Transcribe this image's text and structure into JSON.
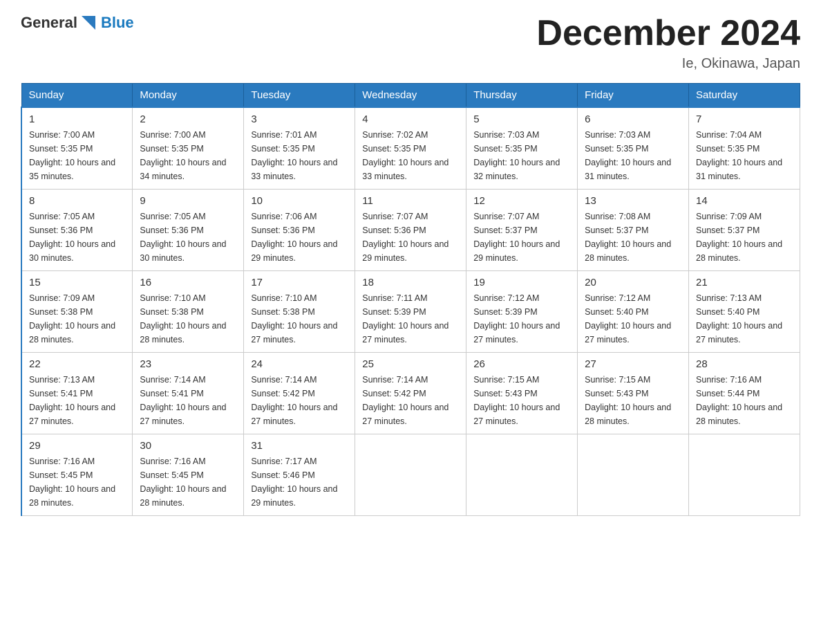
{
  "header": {
    "logo_general": "General",
    "logo_blue": "Blue",
    "title": "December 2024",
    "location": "Ie, Okinawa, Japan"
  },
  "days_of_week": [
    "Sunday",
    "Monday",
    "Tuesday",
    "Wednesday",
    "Thursday",
    "Friday",
    "Saturday"
  ],
  "weeks": [
    [
      {
        "day": "1",
        "sunrise": "7:00 AM",
        "sunset": "5:35 PM",
        "daylight": "10 hours and 35 minutes."
      },
      {
        "day": "2",
        "sunrise": "7:00 AM",
        "sunset": "5:35 PM",
        "daylight": "10 hours and 34 minutes."
      },
      {
        "day": "3",
        "sunrise": "7:01 AM",
        "sunset": "5:35 PM",
        "daylight": "10 hours and 33 minutes."
      },
      {
        "day": "4",
        "sunrise": "7:02 AM",
        "sunset": "5:35 PM",
        "daylight": "10 hours and 33 minutes."
      },
      {
        "day": "5",
        "sunrise": "7:03 AM",
        "sunset": "5:35 PM",
        "daylight": "10 hours and 32 minutes."
      },
      {
        "day": "6",
        "sunrise": "7:03 AM",
        "sunset": "5:35 PM",
        "daylight": "10 hours and 31 minutes."
      },
      {
        "day": "7",
        "sunrise": "7:04 AM",
        "sunset": "5:35 PM",
        "daylight": "10 hours and 31 minutes."
      }
    ],
    [
      {
        "day": "8",
        "sunrise": "7:05 AM",
        "sunset": "5:36 PM",
        "daylight": "10 hours and 30 minutes."
      },
      {
        "day": "9",
        "sunrise": "7:05 AM",
        "sunset": "5:36 PM",
        "daylight": "10 hours and 30 minutes."
      },
      {
        "day": "10",
        "sunrise": "7:06 AM",
        "sunset": "5:36 PM",
        "daylight": "10 hours and 29 minutes."
      },
      {
        "day": "11",
        "sunrise": "7:07 AM",
        "sunset": "5:36 PM",
        "daylight": "10 hours and 29 minutes."
      },
      {
        "day": "12",
        "sunrise": "7:07 AM",
        "sunset": "5:37 PM",
        "daylight": "10 hours and 29 minutes."
      },
      {
        "day": "13",
        "sunrise": "7:08 AM",
        "sunset": "5:37 PM",
        "daylight": "10 hours and 28 minutes."
      },
      {
        "day": "14",
        "sunrise": "7:09 AM",
        "sunset": "5:37 PM",
        "daylight": "10 hours and 28 minutes."
      }
    ],
    [
      {
        "day": "15",
        "sunrise": "7:09 AM",
        "sunset": "5:38 PM",
        "daylight": "10 hours and 28 minutes."
      },
      {
        "day": "16",
        "sunrise": "7:10 AM",
        "sunset": "5:38 PM",
        "daylight": "10 hours and 28 minutes."
      },
      {
        "day": "17",
        "sunrise": "7:10 AM",
        "sunset": "5:38 PM",
        "daylight": "10 hours and 27 minutes."
      },
      {
        "day": "18",
        "sunrise": "7:11 AM",
        "sunset": "5:39 PM",
        "daylight": "10 hours and 27 minutes."
      },
      {
        "day": "19",
        "sunrise": "7:12 AM",
        "sunset": "5:39 PM",
        "daylight": "10 hours and 27 minutes."
      },
      {
        "day": "20",
        "sunrise": "7:12 AM",
        "sunset": "5:40 PM",
        "daylight": "10 hours and 27 minutes."
      },
      {
        "day": "21",
        "sunrise": "7:13 AM",
        "sunset": "5:40 PM",
        "daylight": "10 hours and 27 minutes."
      }
    ],
    [
      {
        "day": "22",
        "sunrise": "7:13 AM",
        "sunset": "5:41 PM",
        "daylight": "10 hours and 27 minutes."
      },
      {
        "day": "23",
        "sunrise": "7:14 AM",
        "sunset": "5:41 PM",
        "daylight": "10 hours and 27 minutes."
      },
      {
        "day": "24",
        "sunrise": "7:14 AM",
        "sunset": "5:42 PM",
        "daylight": "10 hours and 27 minutes."
      },
      {
        "day": "25",
        "sunrise": "7:14 AM",
        "sunset": "5:42 PM",
        "daylight": "10 hours and 27 minutes."
      },
      {
        "day": "26",
        "sunrise": "7:15 AM",
        "sunset": "5:43 PM",
        "daylight": "10 hours and 27 minutes."
      },
      {
        "day": "27",
        "sunrise": "7:15 AM",
        "sunset": "5:43 PM",
        "daylight": "10 hours and 28 minutes."
      },
      {
        "day": "28",
        "sunrise": "7:16 AM",
        "sunset": "5:44 PM",
        "daylight": "10 hours and 28 minutes."
      }
    ],
    [
      {
        "day": "29",
        "sunrise": "7:16 AM",
        "sunset": "5:45 PM",
        "daylight": "10 hours and 28 minutes."
      },
      {
        "day": "30",
        "sunrise": "7:16 AM",
        "sunset": "5:45 PM",
        "daylight": "10 hours and 28 minutes."
      },
      {
        "day": "31",
        "sunrise": "7:17 AM",
        "sunset": "5:46 PM",
        "daylight": "10 hours and 29 minutes."
      },
      null,
      null,
      null,
      null
    ]
  ]
}
